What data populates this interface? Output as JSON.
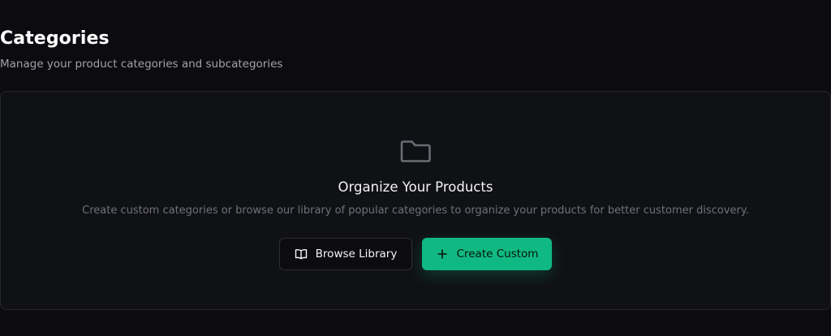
{
  "header": {
    "title": "Categories",
    "subtitle": "Manage your product categories and subcategories"
  },
  "empty_state": {
    "icon": "folder-icon",
    "title": "Organize Your Products",
    "description": "Create custom categories or browse our library of popular categories to organize your products for better customer discovery."
  },
  "actions": {
    "browse_label": "Browse Library",
    "browse_icon": "book-open-icon",
    "create_label": "Create Custom",
    "create_icon": "plus-icon"
  },
  "colors": {
    "background": "#0c0c10",
    "card": "#101115",
    "accent": "#10b981",
    "muted_text": "#71717a"
  }
}
